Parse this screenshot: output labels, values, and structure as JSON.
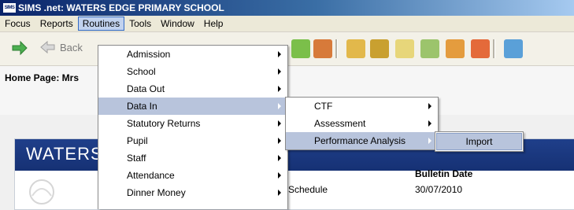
{
  "window": {
    "app_icon": "SIMS",
    "title": "SIMS .net: WATERS EDGE PRIMARY SCHOOL"
  },
  "menubar": {
    "items": [
      {
        "label": "Focus"
      },
      {
        "label": "Reports"
      },
      {
        "label": "Routines"
      },
      {
        "label": "Tools"
      },
      {
        "label": "Window"
      },
      {
        "label": "Help"
      }
    ]
  },
  "toolbar": {
    "back_label": "Back",
    "icons": [
      "forward-arrow-icon",
      "back-arrow-icon",
      "contacts-icon",
      "staff-icon",
      "assessment-icon",
      "pupil-icon",
      "reports-icon",
      "marksheet-icon",
      "person-icon",
      "clock-icon",
      "tools-icon"
    ]
  },
  "home": {
    "header": "Home Page: Mrs",
    "school_name_partial": "WATERS",
    "table": {
      "col_bulletin_date": "Bulletin Date",
      "row1_title": "Schedule",
      "row1_date": "30/07/2010"
    }
  },
  "routines_menu": {
    "items": [
      {
        "label": "Admission",
        "submenu": true
      },
      {
        "label": "School",
        "submenu": true
      },
      {
        "label": "Data Out",
        "submenu": true
      },
      {
        "label": "Data In",
        "submenu": true,
        "highlighted": true
      },
      {
        "label": "Statutory Returns",
        "submenu": true
      },
      {
        "label": "Pupil",
        "submenu": true
      },
      {
        "label": "Staff",
        "submenu": true
      },
      {
        "label": "Attendance",
        "submenu": true
      },
      {
        "label": "Dinner Money",
        "submenu": true
      }
    ]
  },
  "datain_menu": {
    "items": [
      {
        "label": "CTF",
        "submenu": true
      },
      {
        "label": "Assessment",
        "submenu": true
      },
      {
        "label": "Performance Analysis",
        "submenu": true,
        "highlighted": true
      }
    ]
  },
  "performance_menu": {
    "items": [
      {
        "label": "Import",
        "highlighted": true
      }
    ]
  },
  "colors": {
    "titlebar_start": "#0a246a",
    "menu_highlight": "#b8c4dc",
    "school_banner": "#1f3f8a"
  }
}
